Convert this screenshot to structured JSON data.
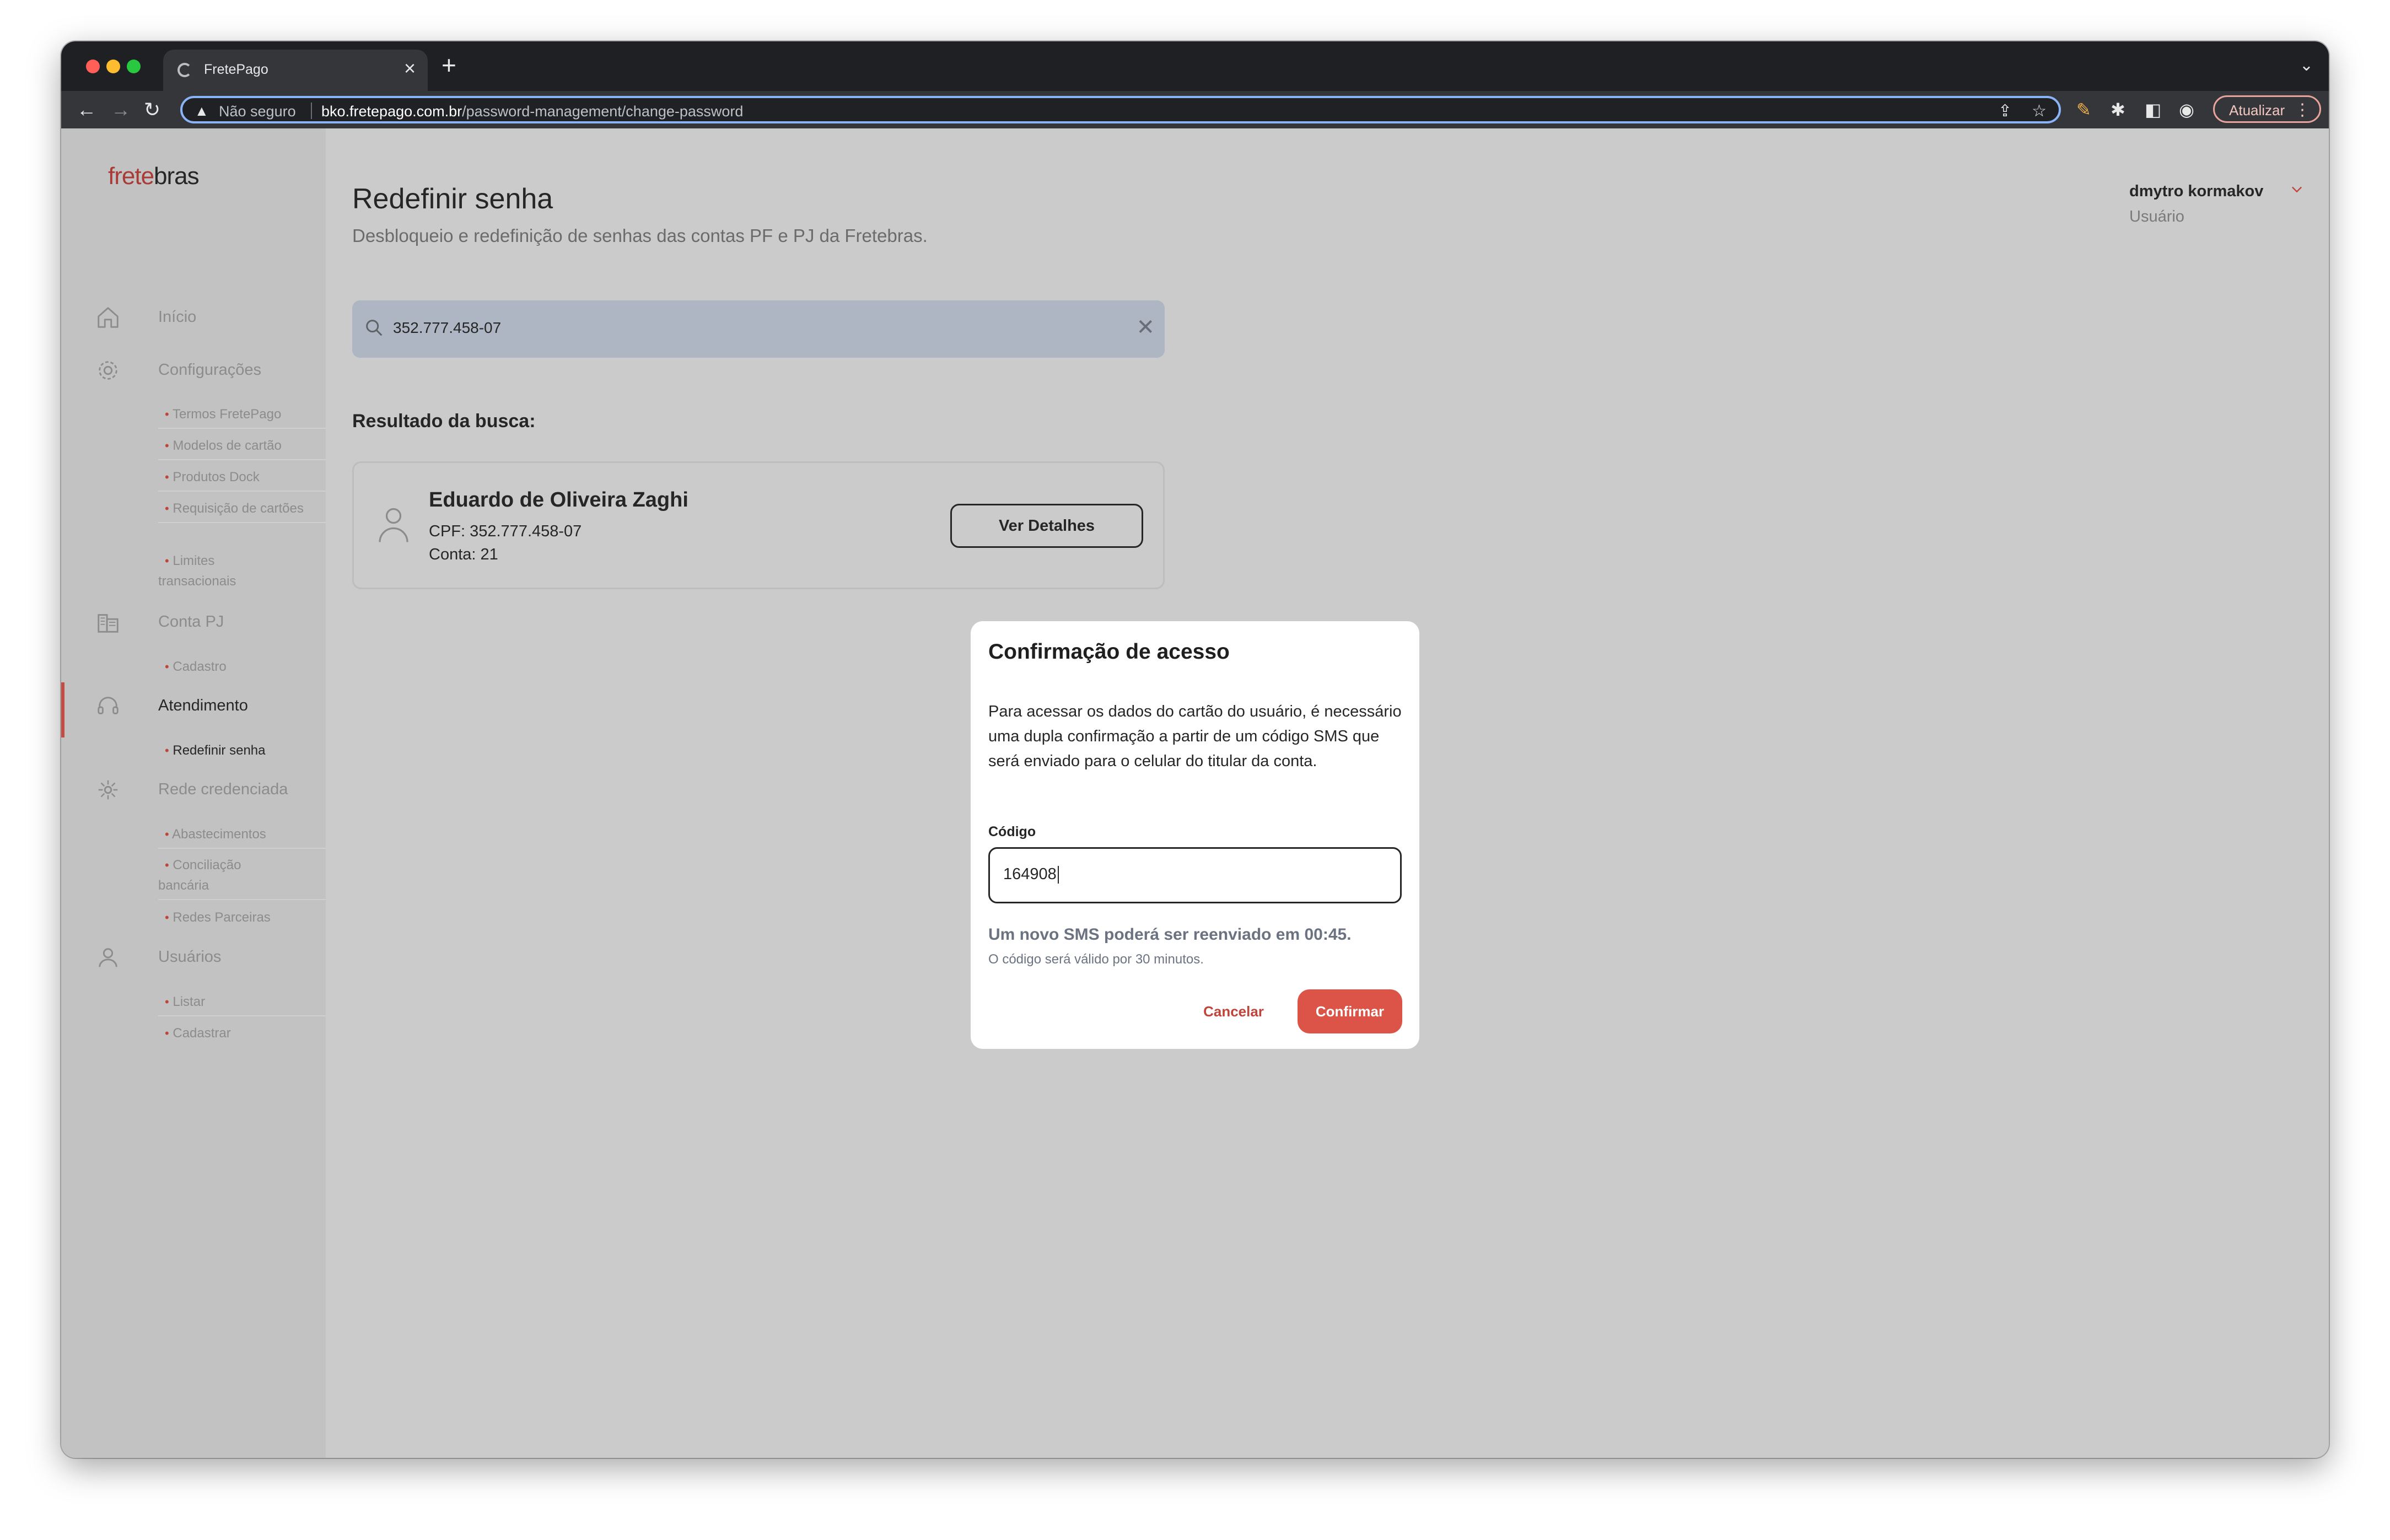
{
  "browser": {
    "tab_title": "FretePago",
    "new_tab_glyph": "+",
    "tab_close_glyph": "×",
    "security_label": "Não seguro",
    "url_host": "bko.fretepago.com.br",
    "url_path": "/password-management/change-password",
    "update_label": "Atualizar",
    "traffic_colors": [
      "#ff5f57",
      "#febc2e",
      "#28c840"
    ]
  },
  "sidebar": {
    "logo_red": "frete",
    "logo_dark": "bras",
    "groups": [
      {
        "label": "Início",
        "icon": "home-icon",
        "items": []
      },
      {
        "label": "Configurações",
        "icon": "gear-icon",
        "items": [
          "Termos FretePago",
          "Modelos de cartão",
          "Produtos Dock",
          "Requisição de cartões",
          "Limites transacionais"
        ]
      },
      {
        "label": "Conta PJ",
        "icon": "building-icon",
        "items": [
          "Cadastro"
        ]
      },
      {
        "label": "Atendimento",
        "icon": "headset-icon",
        "items": [
          "Redefinir senha"
        ]
      },
      {
        "label": "Rede credenciada",
        "icon": "network-icon",
        "items": [
          "Abastecimentos",
          "Conciliação bancária",
          "Redes Parceiras"
        ]
      },
      {
        "label": "Usuários",
        "icon": "user-icon",
        "items": [
          "Listar",
          "Cadastrar"
        ]
      }
    ],
    "active_item": "Redefinir senha"
  },
  "header": {
    "title": "Redefinir senha",
    "subtitle": "Desbloqueio e redefinição de senhas das contas PF e PJ da Fretebras.",
    "user_name": "dmytro kormakov",
    "user_role": "Usuário"
  },
  "search": {
    "value": "352.777.458-07",
    "clear_glyph": "✕"
  },
  "results": {
    "label": "Resultado da busca:",
    "card": {
      "name": "Eduardo de Oliveira Zaghi",
      "cpf": "CPF: 352.777.458-07",
      "account": "Conta: 21",
      "details_label": "Ver Detalhes"
    }
  },
  "modal": {
    "title": "Confirmação de acesso",
    "body": "Para acessar os dados do cartão do usuário, é necessário uma dupla confirmação a partir de um código SMS que será enviado para o celular do titular da conta.",
    "code_label": "Código",
    "code_value": "164908",
    "resend_notice": "Um novo SMS poderá ser reenviado em 00:45.",
    "validity_notice": "O código será válido por 30 minutos.",
    "cancel_label": "Cancelar",
    "confirm_label": "Confirmar"
  },
  "colors": {
    "brand_red": "#dc5347",
    "overlay_gray": "#cbcbcb",
    "focus_ring": "#8ab4f8"
  }
}
